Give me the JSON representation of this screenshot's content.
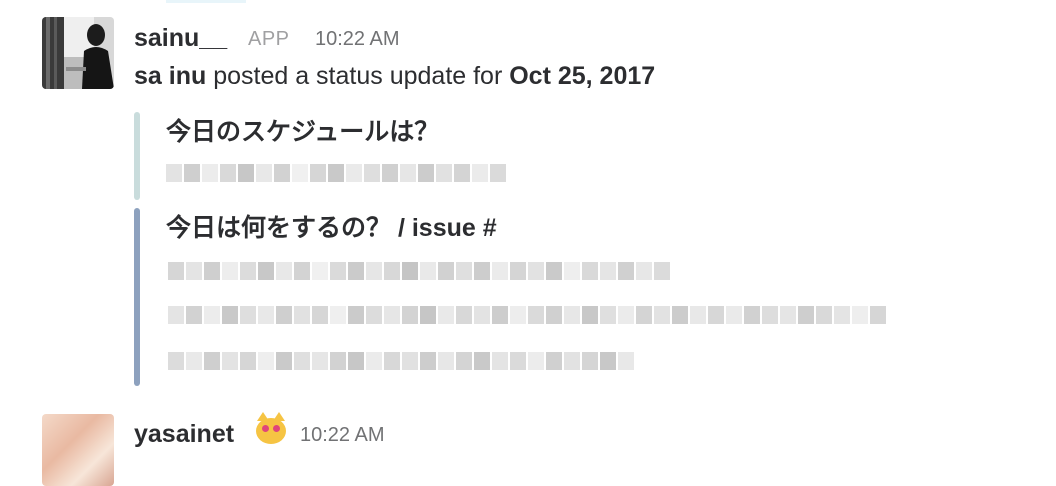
{
  "message": {
    "sender": "sainu__",
    "badge": "APP",
    "time": "10:22 AM",
    "body_prefix": "sa inu",
    "body_middle": " posted a status update for ",
    "body_date": "Oct 25, 2017",
    "attachments": [
      {
        "title": "今日のスケジュールは？",
        "bar_color": "#c9dcdc"
      },
      {
        "title": "今日は何をするの？ / issue #",
        "bar_color": "#8da1be"
      }
    ]
  },
  "next_message": {
    "sender": "yasainet",
    "emoji": "heart-eyes-cat",
    "time": "10:22 AM"
  }
}
